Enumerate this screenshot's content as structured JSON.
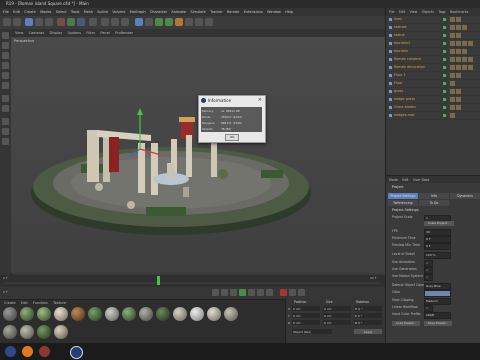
{
  "window": {
    "title": "R19 - [Roman island Square.c4d *] - Main"
  },
  "menubar": [
    "File",
    "Edit",
    "Create",
    "Modes",
    "Select",
    "Tools",
    "Mesh",
    "Spline",
    "Volume",
    "MoGraph",
    "Character",
    "Animate",
    "Simulate",
    "Tracker",
    "Render",
    "Extensions",
    "Window",
    "Help"
  ],
  "viewport": {
    "menu": [
      "View",
      "Cameras",
      "Display",
      "Options",
      "Filter",
      "Panel",
      "ProRender"
    ],
    "label": "Perspective"
  },
  "info_dialog": {
    "title": "Information",
    "rows": [
      {
        "label": "Memory",
        "value": "ca. 98611 KB"
      },
      {
        "label": "Points",
        "value": "455017 (1204)"
      },
      {
        "label": "Polygons",
        "value": "868311 (1268)"
      },
      {
        "label": "Objects",
        "value": "38 (86)"
      }
    ],
    "ok_label": "OK"
  },
  "object_manager": {
    "menu": [
      "File",
      "Edit",
      "View",
      "Objects",
      "Tags",
      "Bookmarks"
    ],
    "objects": [
      {
        "name": "lines"
      },
      {
        "name": "statues"
      },
      {
        "name": "statue"
      },
      {
        "name": "fountain2"
      },
      {
        "name": "fountain"
      },
      {
        "name": "Roman columns"
      },
      {
        "name": "Roman decoration"
      },
      {
        "name": "Floor 1"
      },
      {
        "name": "Floor"
      },
      {
        "name": "grass"
      },
      {
        "name": "hedge grass"
      },
      {
        "name": "Grass blades"
      },
      {
        "name": "hedges-mat"
      }
    ]
  },
  "attributes": {
    "menu": [
      "Mode",
      "Edit",
      "User Data"
    ],
    "header": "Project",
    "tabs": [
      "Project Settings",
      "Info",
      "Dynamics"
    ],
    "tabs2": [
      "Referencing",
      "To Do"
    ],
    "section": "Project Settings",
    "rows": [
      {
        "label": "Project Scale",
        "value": "1"
      },
      {
        "label": "FPS",
        "value": "30"
      },
      {
        "label": "Minimum Time",
        "value": "0 F"
      },
      {
        "label": "Preview Min Time",
        "value": "0 F"
      },
      {
        "label": "Level of Detail",
        "value": "100 %"
      },
      {
        "label": "Use Animation",
        "value": "✓"
      },
      {
        "label": "Use Generators",
        "value": "✓"
      },
      {
        "label": "Use Motion System",
        "value": "✓"
      },
      {
        "label": "Default Object Color",
        "value": "Gray Blue"
      },
      {
        "label": "Color",
        "value": ""
      },
      {
        "label": "View Clipping",
        "value": "Medium"
      },
      {
        "label": "Linear Workflow",
        "value": "✓"
      },
      {
        "label": "Input Color Profile",
        "value": "sRGB"
      }
    ],
    "buttons": [
      "Scale Project...",
      "Load Preset...",
      "Save Preset..."
    ]
  },
  "coordinates": {
    "headers": [
      "Position",
      "Size",
      "Rotation"
    ],
    "rows": [
      {
        "axis": "X",
        "pos": "0 cm",
        "size": "0 cm",
        "rot": "H 0 °"
      },
      {
        "axis": "Y",
        "pos": "0 cm",
        "size": "0 cm",
        "rot": "P 0 °"
      },
      {
        "axis": "Z",
        "pos": "0 cm",
        "size": "0 cm",
        "rot": "B 0 °"
      }
    ],
    "mode": "Object (Rel)",
    "apply_label": "Apply"
  },
  "materials_menu": [
    "Create",
    "Edit",
    "Function",
    "Texture"
  ],
  "timeline": {
    "start": "0 F",
    "end": "90 F",
    "current": "0 F"
  }
}
